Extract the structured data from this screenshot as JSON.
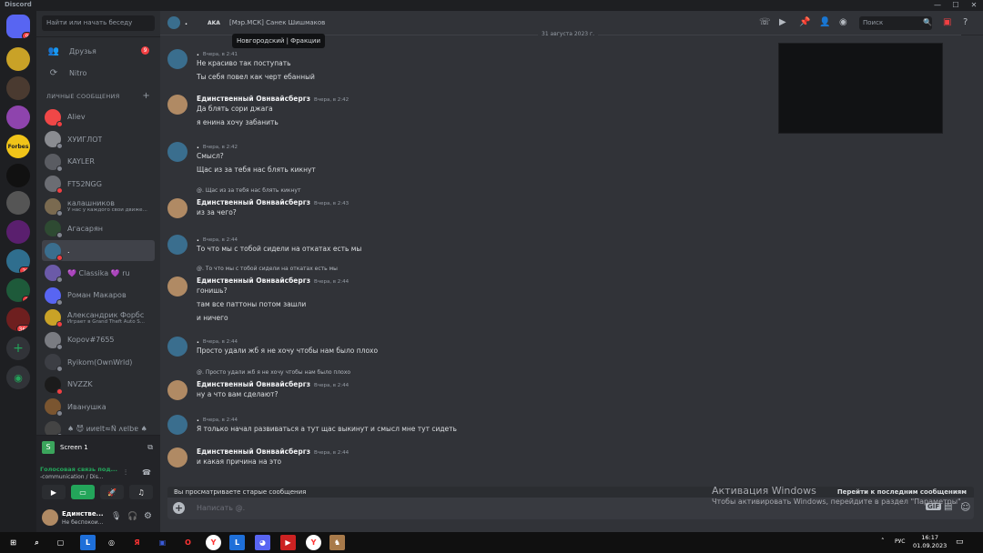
{
  "app": {
    "title": "Discord"
  },
  "sidebar": {
    "search_placeholder": "Найти или начать беседу",
    "friends_label": "Друзья",
    "friends_badge": "9",
    "nitro_label": "Nitro",
    "dm_header": "ЛИЧНЫЕ СООБЩЕНИЯ",
    "dms": [
      {
        "name": "Aliev",
        "sub": "",
        "color": "#f04747"
      },
      {
        "name": "ХУИГЛОТ",
        "sub": "",
        "color": "#8a8c91"
      },
      {
        "name": "KAYLER",
        "sub": "",
        "color": "#5a5c62"
      },
      {
        "name": "FT52NGG",
        "sub": "",
        "color": "#6b6d73"
      },
      {
        "name": "калашников",
        "sub": "У нас у каждого свои движе...",
        "color": "#7a6a50"
      },
      {
        "name": "Агасарян",
        "sub": "",
        "color": "#2e4a32"
      },
      {
        "name": ".",
        "sub": "",
        "color": "#3a6e8e"
      },
      {
        "name": "💜 Classika 💜 ru",
        "sub": "",
        "color": "#6b5aa8"
      },
      {
        "name": "Роман Макаров",
        "sub": "",
        "color": "#5865f2"
      },
      {
        "name": "Александрик Форбс",
        "sub": "Играет в Grand Theft Auto S...",
        "color": "#c9a227"
      },
      {
        "name": "Kopov#7655",
        "sub": "",
        "color": "#7a7c82"
      },
      {
        "name": "Ryikom(OwnWrld)",
        "sub": "",
        "color": "#3c3e44"
      },
      {
        "name": "NVZZK",
        "sub": "",
        "color": "#1b1b1b"
      },
      {
        "name": "Иванушка",
        "sub": "",
        "color": "#7a5530"
      },
      {
        "name": "♠ 😈 ᴎᴎɐlt≈Ñ ʌɐlbɐ ♠",
        "sub": "",
        "color": "#444"
      }
    ]
  },
  "guilds": [
    {
      "label": "",
      "badge": "9",
      "color": "#5865f2"
    },
    {
      "label": "",
      "badge": "",
      "color": "#c9a227"
    },
    {
      "label": "",
      "badge": "",
      "color": "#4a3a30"
    },
    {
      "label": "",
      "badge": "",
      "color": "#8e44ad"
    },
    {
      "label": "Forbes",
      "badge": "",
      "color": "#f0c419"
    },
    {
      "label": "",
      "badge": "",
      "color": "#111"
    },
    {
      "label": "",
      "badge": "",
      "color": "#555"
    },
    {
      "label": "",
      "badge": "",
      "color": "#5a1f6e"
    },
    {
      "label": "",
      "badge": "29",
      "color": "#2f6e8e"
    },
    {
      "label": "",
      "badge": "1",
      "color": "#1e5a3a"
    },
    {
      "label": "",
      "badge": "360",
      "color": "#6e1f1f"
    }
  ],
  "voice": {
    "screen_label": "Screen 1",
    "status": "Голосовая связь под...",
    "channel": "-communication / Dis..."
  },
  "user": {
    "name": "Единстве...",
    "status": "Не беспокои..."
  },
  "header": {
    "channel_name": ".",
    "aka_label": "AKA",
    "aka_names": "[Мэр.МСК] Санек Шишмаков",
    "tooltip": "Новгородский | Фракции",
    "search_placeholder": "Поиск"
  },
  "date_separator": "31 августа 2023 г.",
  "messages": [
    {
      "author": ".",
      "time": "Вчера, в 2:41",
      "reply": "",
      "lines": [
        "Не красиво так поступать",
        "Ты себя повел как черт ебанный"
      ]
    },
    {
      "author": "Единственный Овнвайсбергз",
      "time": "Вчера, в 2:42",
      "reply": "",
      "lines": [
        "Да блять сори джага",
        "я енина хочу забанить"
      ]
    },
    {
      "author": ".",
      "time": "Вчера, в 2:42",
      "reply": "",
      "lines": [
        "Смысл?",
        "Щас из за тебя нас блять кикнут"
      ]
    },
    {
      "author": "Единственный Овнвайсбергз",
      "time": "Вчера, в 2:43",
      "reply": "@. Щас из за тебя нас блять кикнут",
      "lines": [
        "из за чего?"
      ]
    },
    {
      "author": ".",
      "time": "Вчера, в 2:44",
      "reply": "",
      "lines": [
        "То что мы с тобой сидели на откатах есть мы"
      ]
    },
    {
      "author": "Единственный Овнвайсбергз",
      "time": "Вчера, в 2:44",
      "reply": "@. То что мы с тобой сидели на откатах есть мы",
      "lines": [
        "гонишь?",
        "там все паттоны потом зашли",
        "и ничего"
      ]
    },
    {
      "author": ".",
      "time": "Вчера, в 2:44",
      "reply": "",
      "lines": [
        "Просто удали жб я не хочу чтобы нам было плохо"
      ]
    },
    {
      "author": "Единственный Овнвайсбергз",
      "time": "Вчера, в 2:44",
      "reply": "@. Просто удали жб я не хочу чтобы нам было плохо",
      "lines": [
        "ну а что вам сделают?"
      ]
    },
    {
      "author": ".",
      "time": "Вчера, в 2:44",
      "reply": "",
      "lines": [
        "Я только начал развиваться а тут щас выкинут и смысл мне тут сидеть"
      ]
    },
    {
      "author": "Единственный Овнвайсбергз",
      "time": "Вчера, в 2:44",
      "reply": "",
      "lines": [
        "и какая причина на это"
      ]
    }
  ],
  "chat_footer": {
    "old_messages": "Вы просматриваете старые сообщения",
    "jump": "Перейти к последним сообщениям",
    "input_placeholder": "Написать @."
  },
  "watermark": {
    "title": "Активация Windows",
    "subtitle": "Чтобы активировать Windows, перейдите в раздел \"Параметры\"."
  },
  "taskbar": {
    "lang": "РУС",
    "time": "16:17",
    "date": "01.09.2023"
  }
}
